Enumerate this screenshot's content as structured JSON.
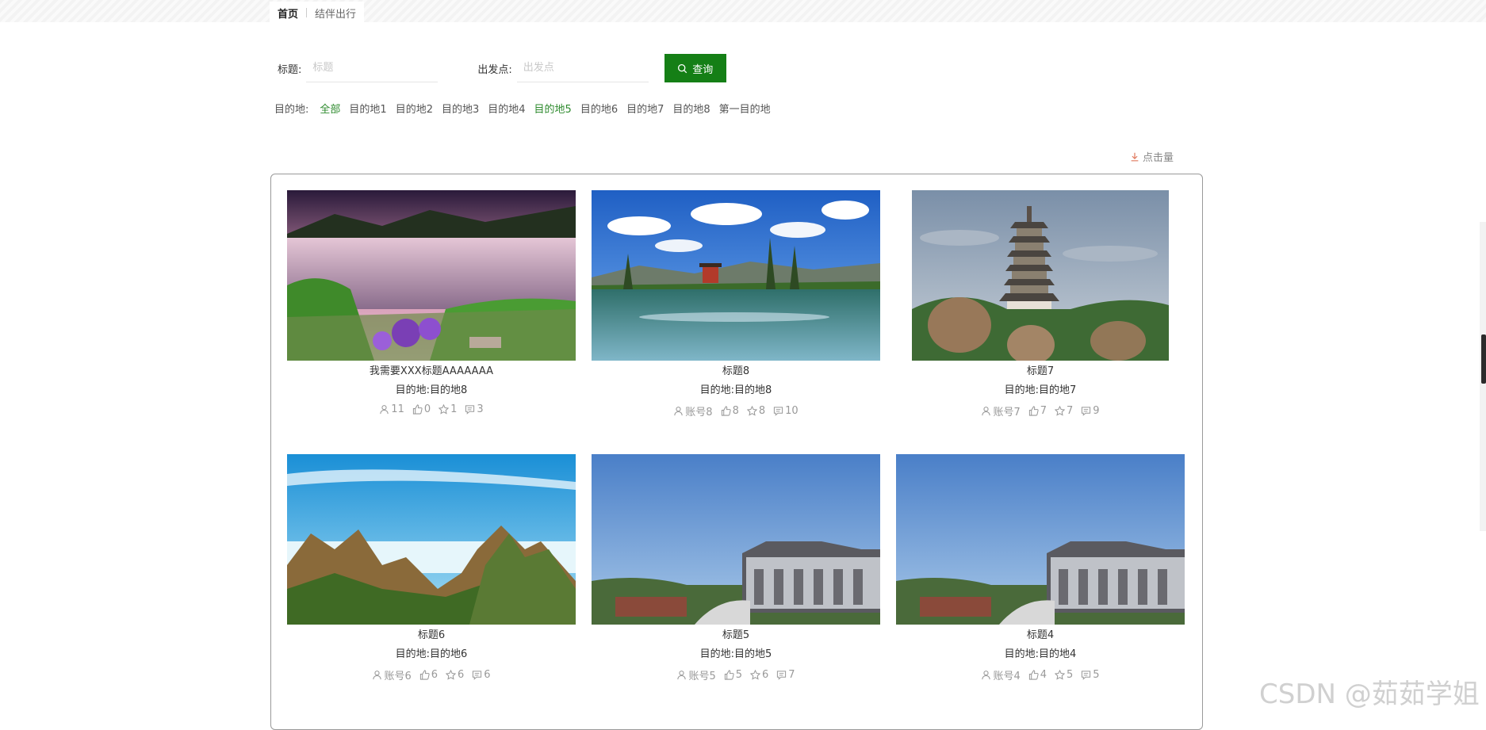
{
  "breadcrumb": {
    "home": "首页",
    "current": "结伴出行"
  },
  "search": {
    "title_label": "标题:",
    "title_placeholder": "标题",
    "origin_label": "出发点:",
    "origin_placeholder": "出发点",
    "button_label": "查询"
  },
  "destinations": {
    "label": "目的地:",
    "items": [
      "全部",
      "目的地1",
      "目的地2",
      "目的地3",
      "目的地4",
      "目的地5",
      "目的地6",
      "目的地7",
      "目的地8",
      "第一目的地"
    ]
  },
  "sort": {
    "label": "点击量"
  },
  "cards": [
    {
      "title": "我需要XXX标题AAAAAAA",
      "dest": "目的地:目的地8",
      "user": "11",
      "likes": "0",
      "stars": "1",
      "comments": "3",
      "icon": "lake-flowers-photo"
    },
    {
      "title": "标题8",
      "dest": "目的地:目的地8",
      "user": "账号8",
      "likes": "8",
      "stars": "8",
      "comments": "10",
      "icon": "lake-temple-photo"
    },
    {
      "title": "标题7",
      "dest": "目的地:目的地7",
      "user": "账号7",
      "likes": "7",
      "stars": "7",
      "comments": "9",
      "icon": "pagoda-photo"
    },
    {
      "title": "标题6",
      "dest": "目的地:目的地6",
      "user": "账号6",
      "likes": "6",
      "stars": "6",
      "comments": "6",
      "icon": "mountains-clouds-photo"
    },
    {
      "title": "标题5",
      "dest": "目的地:目的地5",
      "user": "账号5",
      "likes": "5",
      "stars": "6",
      "comments": "7",
      "icon": "marble-boat-photo"
    },
    {
      "title": "标题4",
      "dest": "目的地:目的地4",
      "user": "账号4",
      "likes": "4",
      "stars": "5",
      "comments": "5",
      "icon": "marble-boat-photo"
    }
  ],
  "watermark": "CSDN @茹茹学姐",
  "colors": {
    "accent": "#157f16",
    "active_link": "#2e8b2e"
  }
}
